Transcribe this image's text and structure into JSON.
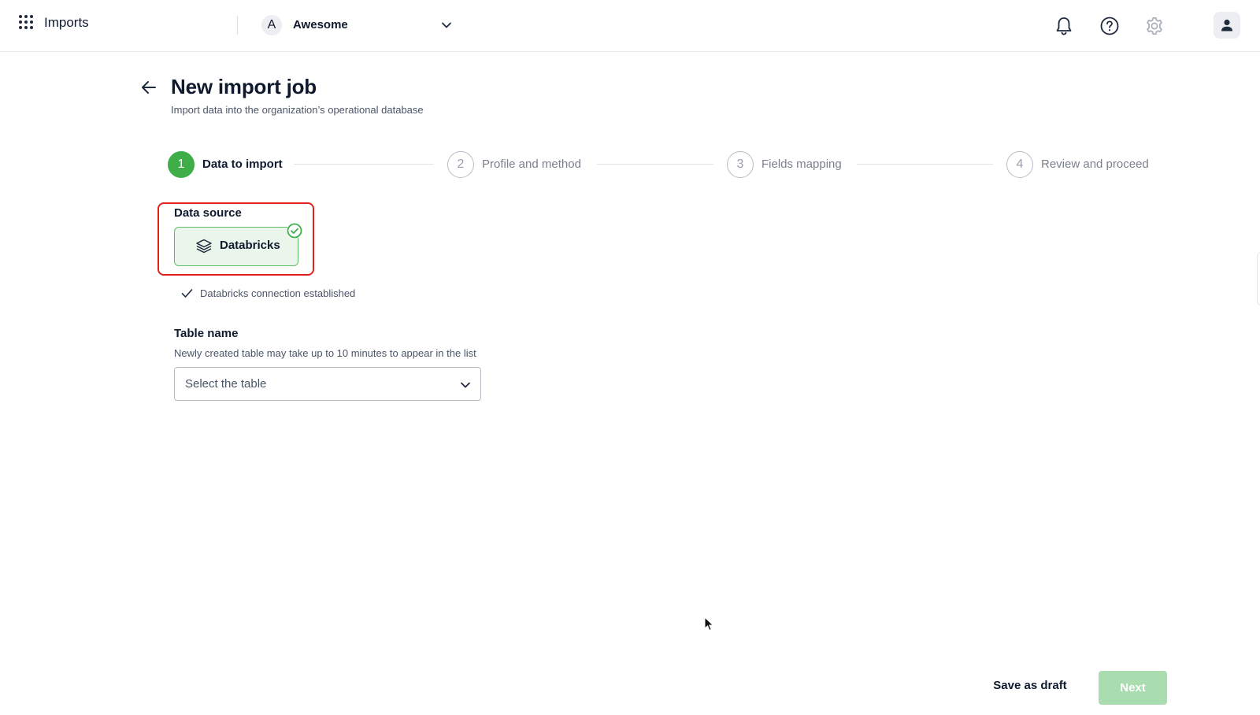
{
  "header": {
    "app_title": "Imports",
    "org": {
      "initial": "A",
      "name": "Awesome"
    },
    "icons": [
      "apps-grid-icon",
      "bell-icon",
      "help-icon",
      "gear-icon",
      "user-icon"
    ]
  },
  "page": {
    "title": "New import job",
    "subtitle": "Import data into the organization’s operational database"
  },
  "stepper": {
    "active_step": 1,
    "steps": [
      {
        "number": "1",
        "label": "Data to import"
      },
      {
        "number": "2",
        "label": "Profile and method"
      },
      {
        "number": "3",
        "label": "Fields mapping"
      },
      {
        "number": "4",
        "label": "Review and proceed"
      }
    ]
  },
  "data_source": {
    "label": "Data source",
    "selected": "Databricks",
    "status_text": "Databricks connection established"
  },
  "table_name": {
    "label": "Table name",
    "help_text": "Newly created table may take up to 10 minutes to appear in the list",
    "placeholder": "Select the table"
  },
  "footer": {
    "save_draft_label": "Save as draft",
    "next_label": "Next"
  },
  "colors": {
    "accent_green": "#3fae49",
    "next_disabled": "#a9dcaf",
    "highlight_red": "#e3211c",
    "text_primary": "#0f1a2e"
  }
}
